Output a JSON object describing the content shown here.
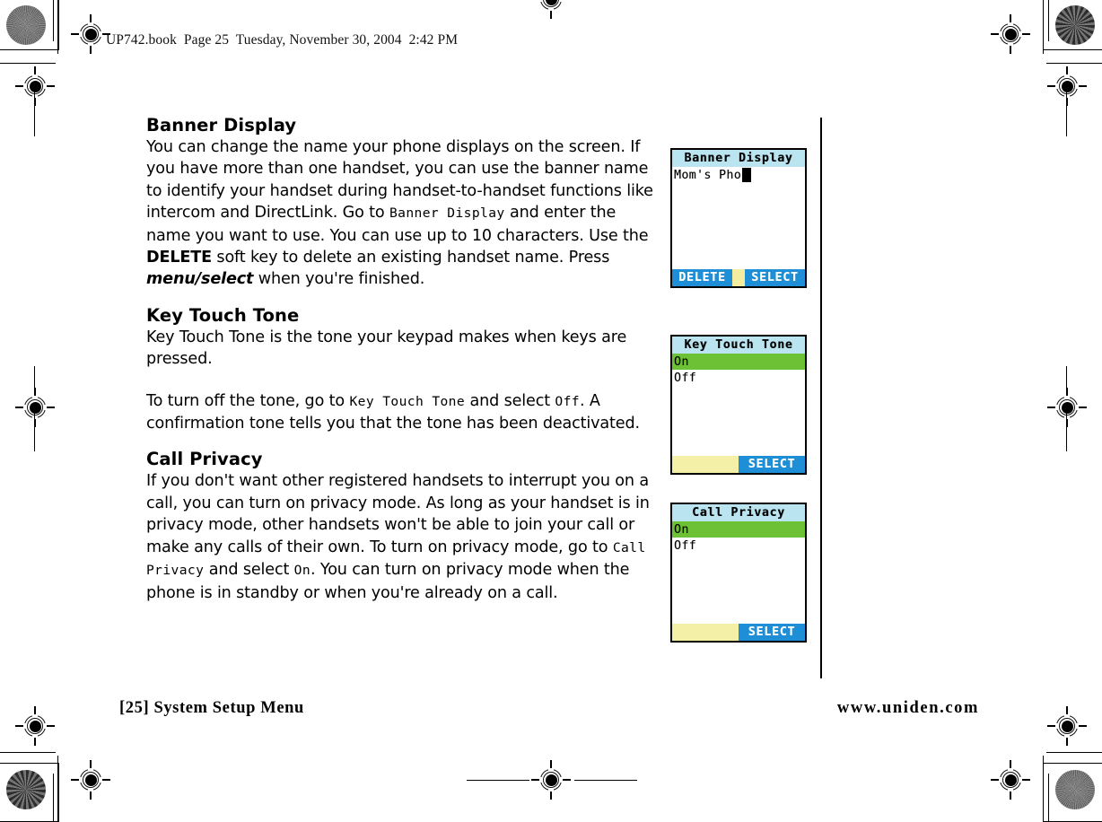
{
  "page": {
    "running_head": "UP742.book  Page 25  Tuesday, November 30, 2004  2:42 PM",
    "footer_left": "[25] System Setup Menu",
    "footer_right": "www.uniden.com",
    "page_number": "25",
    "section_name": "System Setup Menu"
  },
  "colors": {
    "lcd_title_bar": "#b9e4f0",
    "lcd_highlight": "#6cc234",
    "softkey_blue": "#1e8ed6",
    "softkey_yellow": "#f4f0a8",
    "text": "#000000",
    "page_bg": "#ffffff"
  },
  "sections": [
    {
      "heading": "Banner Display",
      "paragraphs": [
        {
          "runs": [
            {
              "kind": "plain",
              "text": "You can change the name your phone displays on the screen. If you have more than one handset, you can use the banner name to identify your handset during handset-to-handset functions like intercom and DirectLink. Go to "
            },
            {
              "kind": "lcd",
              "text": "Banner Display"
            },
            {
              "kind": "plain",
              "text": " and enter the name you want to use. You can use up to 10 characters. Use the "
            },
            {
              "kind": "softkey",
              "text": "DELETE"
            },
            {
              "kind": "plain",
              "text": " soft key to delete an existing handset name. Press "
            },
            {
              "kind": "keyname",
              "text": "menu/select"
            },
            {
              "kind": "plain",
              "text": " when you're finished."
            }
          ]
        }
      ]
    },
    {
      "heading": "Key Touch Tone",
      "paragraphs": [
        {
          "runs": [
            {
              "kind": "plain",
              "text": "Key Touch Tone is the tone your keypad makes when keys are pressed."
            }
          ]
        },
        {
          "runs": [
            {
              "kind": "plain",
              "text": "To turn off the tone, go to "
            },
            {
              "kind": "lcd",
              "text": "Key Touch Tone"
            },
            {
              "kind": "plain",
              "text": " and select "
            },
            {
              "kind": "lcd",
              "text": "Off"
            },
            {
              "kind": "plain",
              "text": ". A confirmation tone tells you that the tone has been deactivated."
            }
          ]
        }
      ]
    },
    {
      "heading": "Call Privacy",
      "paragraphs": [
        {
          "runs": [
            {
              "kind": "plain",
              "text": "If you don't want other registered handsets to interrupt you on a call, you can turn on privacy mode. As long as your handset is in privacy mode, other handsets won't be able to join your call or make any calls of their own. To turn on privacy mode, go to "
            },
            {
              "kind": "lcd",
              "text": "Call Privacy"
            },
            {
              "kind": "plain",
              "text": " and select "
            },
            {
              "kind": "lcd",
              "text": "On"
            },
            {
              "kind": "plain",
              "text": ". You can turn on privacy mode when the phone is in standby or when you're already on a call."
            }
          ]
        }
      ]
    }
  ],
  "screens": [
    {
      "id": "banner-display",
      "title": "Banner Display",
      "kind": "text-entry",
      "entry_value": "Mom's Pho",
      "cursor_visible": true,
      "softkeys": [
        {
          "label": "DELETE",
          "style": "blue"
        },
        {
          "label": "",
          "style": "yellow-divider"
        },
        {
          "label": "SELECT",
          "style": "blue"
        }
      ]
    },
    {
      "id": "key-touch-tone",
      "title": "Key Touch Tone",
      "kind": "option-list",
      "options": [
        {
          "label": "On",
          "selected": true
        },
        {
          "label": "Off",
          "selected": false
        }
      ],
      "softkeys": [
        {
          "label": "",
          "style": "yellow-blank"
        },
        {
          "label": "SELECT",
          "style": "blue"
        }
      ]
    },
    {
      "id": "call-privacy",
      "title": "Call Privacy",
      "kind": "option-list",
      "options": [
        {
          "label": "On",
          "selected": true
        },
        {
          "label": "Off",
          "selected": false
        }
      ],
      "softkeys": [
        {
          "label": "",
          "style": "yellow-blank"
        },
        {
          "label": "SELECT",
          "style": "blue"
        }
      ]
    }
  ]
}
